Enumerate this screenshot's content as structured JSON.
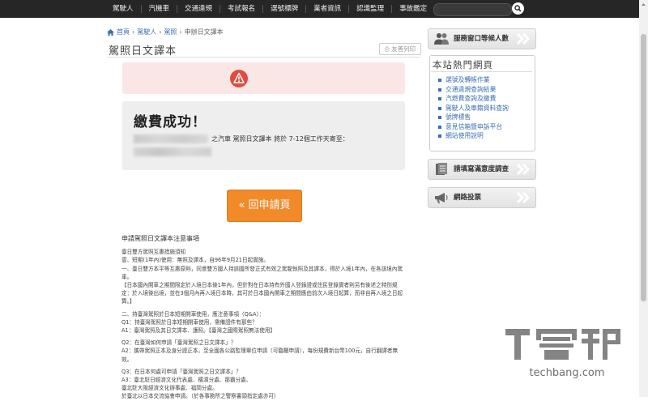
{
  "topnav": {
    "items": [
      "駕駛人",
      "汽機車",
      "交通違規",
      "考試報名",
      "選號標牌",
      "業者資訊",
      "認識監理",
      "事故鑑定"
    ],
    "search_placeholder": ""
  },
  "breadcrumb": {
    "home": "首頁",
    "level1": "駕駛人",
    "level2": "駕照",
    "current": "申辦日文譯本",
    "separator": "›"
  },
  "page": {
    "title": "駕照日文譯本",
    "print_label": "友善列印"
  },
  "success": {
    "title": "繳費成功！",
    "message": "之汽車 駕照日文譯本 將於 7-12個工作天寄至："
  },
  "back_button": "« 回申請頁",
  "notes": {
    "heading": "申請駕照日文譯本注意事項",
    "paragraphs": [
      "臺日雙方駕照互惠措施須知",
      "壹、短期(1年內)使用：無照及譯本，自96年9月21日起實施。",
      "一、臺日雙方本平等互惠原則，同意雙方國人持該國所發正式有效之駕駛執照及其譯本，得於入境1年內，在各該境內駕車。",
      "【日本國內開車之期間限定於入境日本後1年內，但針對在日本持有外國人登錄證或住民登錄實者則另有後述之特別規定：於入境後出境，並在3個月內再入境日本時，其可於日本國內開車之期間應由前次入境日起算，而非自再入境之日起算。】",
      "二、持臺灣駕照於日本短期開車使用，應注意事項（Q&A）：",
      "Q1：持臺灣駕照於日本短期開車使用，需備證件有那些？",
      "A1：臺灣駕照及其日文譯本、護照。【臺灣之國際駕照無法使用】",
      "Q2：在臺灣如何申請「臺灣駕照之日文譯本」？",
      "A2：攜帶駕照正本及身分證正本，至全國各公路監理單位申請（可臨櫃申請），每份規費新台幣100元，自行翻譯者無效。",
      "Q3：在日本何處可申請「臺灣駕照之日文譯本」？",
      "A3：臺北駐日經濟文化代表處、橫濱分處、那霸分處、",
      "臺北駐大阪經濟文化辦事處、福岡分處。",
      "於臺北以日本交流協會申請。（於各事務所之警察書頭指定處亦可）"
    ]
  },
  "sidebar": {
    "service_queue": "服務窗口等候人數",
    "hot_title": "本站熱門網頁",
    "hot_links": [
      "選號及轉帳作業",
      "交通違規查詢結果",
      "汽燃費查詢及繳費",
      "駕駛人及車籍資料查詢",
      "號牌標售",
      "意見信箱暨申訴平台",
      "網站使用說明"
    ],
    "survey": "請填寫滿意度調查",
    "vote": "網路投票"
  },
  "watermark": {
    "brand": "T客邦",
    "domain": "techbang.com"
  },
  "colors": {
    "nav_bg": "#262626",
    "link": "#3a6fb0",
    "error_bg": "#fbe6e6",
    "error_icon": "#e04b3d",
    "back_button": "#f28a2a"
  }
}
